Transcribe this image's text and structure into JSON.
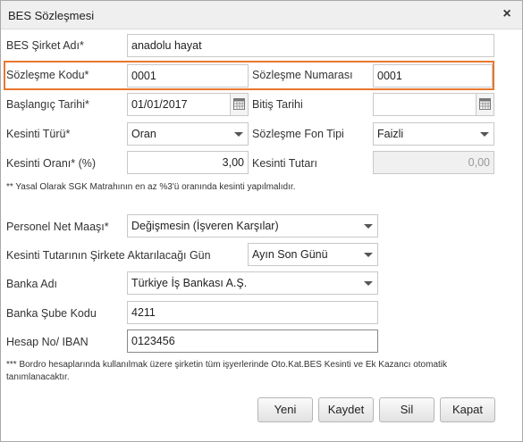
{
  "window": {
    "title": "BES Sözleşmesi",
    "close": "×"
  },
  "form": {
    "company_label": "BES Şirket Adı*",
    "company_value": "anadolu hayat",
    "contract_code_label": "Sözleşme Kodu*",
    "contract_code_value": "0001",
    "contract_number_label": "Sözleşme Numarası",
    "contract_number_value": "0001",
    "start_date_label": "Başlangıç Tarihi*",
    "start_date_value": "01/01/2017",
    "end_date_label": "Bitiş Tarihi",
    "end_date_value": "",
    "deduction_type_label": "Kesinti Türü*",
    "deduction_type_value": "Oran",
    "fund_type_label": "Sözleşme Fon Tipi",
    "fund_type_value": "Faizli",
    "deduction_rate_label": "Kesinti Oranı* (%)",
    "deduction_rate_value": "3,00",
    "deduction_amount_label": "Kesinti Tutarı",
    "deduction_amount_value": "0,00",
    "note1": "** Yasal Olarak SGK Matrahının en az %3'ü oranında kesinti yapılmalıdır.",
    "net_salary_label": "Personel Net Maaşı*",
    "net_salary_value": "Değişmesin (İşveren Karşılar)",
    "transfer_day_label": "Kesinti Tutarının Şirkete Aktarılacağı Gün",
    "transfer_day_value": "Ayın Son Günü",
    "bank_label": "Banka Adı",
    "bank_value": "Türkiye İş Bankası A.Ş.",
    "branch_label": "Banka Şube Kodu",
    "branch_value": "4211",
    "iban_label": "Hesap No/ IBAN",
    "iban_value": "0123456",
    "note2_line1": "*** Bordro hesaplarında kullanılmak üzere şirketin tüm işyerlerinde Oto.Kat.BES Kesinti ve Ek Kazancı otomatik",
    "note2_line2": "tanımlanacaktır."
  },
  "buttons": {
    "new": "Yeni",
    "save": "Kaydet",
    "delete": "Sil",
    "close": "Kapat"
  },
  "icons": {
    "close": "close-icon",
    "calendar": "calendar-icon",
    "dropdown": "chevron-down-icon"
  },
  "colors": {
    "highlight": "#e8772e"
  }
}
